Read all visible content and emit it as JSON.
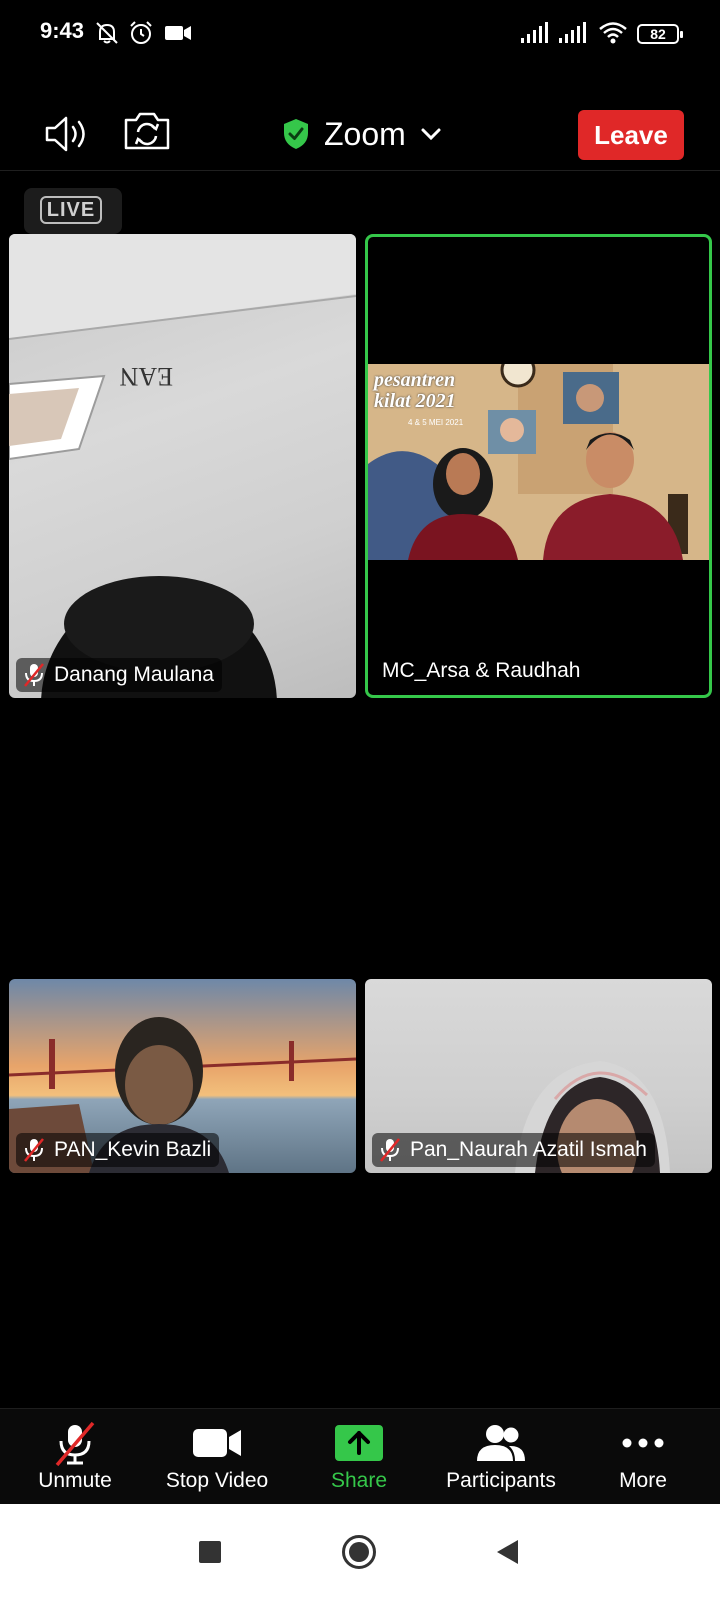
{
  "status_bar": {
    "time": "9:43",
    "battery": "82",
    "icons": [
      "notifications-off-icon",
      "alarm-icon",
      "video-camera-icon",
      "signal-icon",
      "signal-icon",
      "wifi-icon",
      "battery-icon"
    ]
  },
  "header": {
    "app_title": "Zoom",
    "leave_label": "Leave",
    "live_badge": "LIVE",
    "colors": {
      "leave": "#e02828",
      "shield": "#35c74a",
      "active_speaker": "#35c74a"
    }
  },
  "participants": [
    {
      "name": "Danang Maulana",
      "muted": true
    },
    {
      "name": "MC_Arsa & Raudhah",
      "muted": false,
      "active_speaker": true,
      "shared_content": {
        "title_line1": "pesantren",
        "title_line2": "kilat 2021",
        "date": "4 & 5 MEI 2021"
      }
    },
    {
      "name": "PAN_Kevin Bazli",
      "muted": true
    },
    {
      "name": "Pan_Naurah Azatil Ismah",
      "muted": true
    }
  ],
  "toolbar": {
    "unmute_label": "Unmute",
    "stop_video_label": "Stop Video",
    "share_label": "Share",
    "participants_label": "Participants",
    "more_label": "More"
  },
  "nav_bar": {
    "icons": [
      "recents-square-icon",
      "home-circle-icon",
      "back-triangle-icon"
    ]
  }
}
